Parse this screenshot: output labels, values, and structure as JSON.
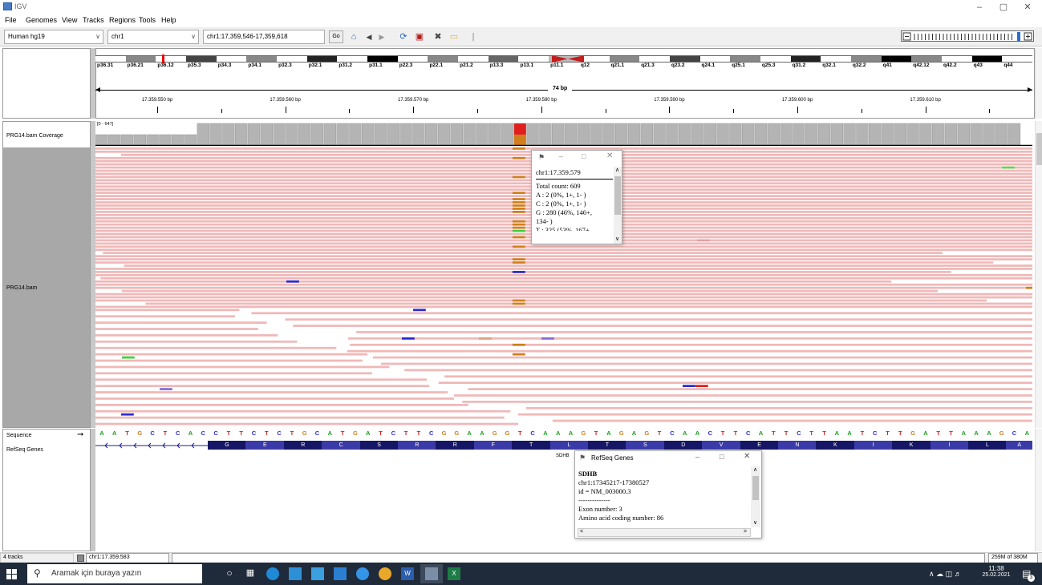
{
  "window": {
    "title": "IGV",
    "controls": [
      "–",
      "▢",
      "✕"
    ]
  },
  "menu": [
    "File",
    "Genomes",
    "View",
    "Tracks",
    "Regions",
    "Tools",
    "Help"
  ],
  "toolbar": {
    "genome": "Human hg19",
    "chromosome": "chr1",
    "locus": "chr1:17,359,546-17,359,618",
    "go_label": "Go"
  },
  "ideogram": {
    "bands": [
      "p36.31",
      "p36.21",
      "p36.12",
      "p35.3",
      "p34.3",
      "p34.1",
      "p32.3",
      "p32.1",
      "p31.2",
      "p31.1",
      "p22.3",
      "p22.1",
      "p21.2",
      "p13.3",
      "p13.1",
      "p11.1",
      "q12",
      "q21.1",
      "q21.3",
      "q23.2",
      "q24.1",
      "q25.1",
      "q25.3",
      "q31.2",
      "q32.1",
      "q32.2",
      "q41",
      "q42.12",
      "q42.2",
      "q43",
      "q44"
    ]
  },
  "ruler": {
    "span": "74 bp",
    "labels": [
      "17.359.550 bp",
      "17.359.560 bp",
      "17.359.570 bp",
      "17.359.580 bp",
      "17.359.590 bp",
      "17.359.600 bp",
      "17.359.610 bp"
    ]
  },
  "tracks": {
    "coverage_name": "PRG14.bam Coverage",
    "coverage_range": "[0 - 647]",
    "alignment_name": "PRG14.bam",
    "sequence_name": "Sequence",
    "refseq_name": "RefSeq Genes"
  },
  "sequence": "AATGCTCACCTTCTCTGCATGATCTTCGGAAGGTCAAAGTAGAGTCAACTTCATTCTTAATCTTGATTAAAGCA",
  "amino_acids": [
    "G",
    "E",
    "R",
    "C",
    "S",
    "R",
    "R",
    "F",
    "T",
    "L",
    "T",
    "S",
    "D",
    "V",
    "E",
    "N",
    "K",
    "I",
    "K",
    "I",
    "L",
    "A"
  ],
  "gene_label": "SDHB",
  "coverage_popup": {
    "locus": "chr1:17.359.579",
    "lines": [
      "Total count: 609",
      "A : 2 (0%, 1+, 1- )",
      "C : 2 (0%, 1+, 1- )",
      "G : 280 (46%, 146+,",
      "134- )",
      "T : 325 (53%, 167+,"
    ]
  },
  "refseq_popup": {
    "title": "RefSeq Genes",
    "gene": "SDHB",
    "lines": [
      "chr1:17345217-17380527",
      "id = NM_003000.3",
      "--------------",
      "Exon number: 3",
      "Amino acid coding number: 86"
    ]
  },
  "status": {
    "tracks": "4 tracks",
    "position": "chr1:17.359.583",
    "memory": "259M of 380M"
  },
  "taskbar": {
    "search_placeholder": "Aramak için buraya yazın",
    "time": "11:38",
    "date": "25.02.2021",
    "notif_count": "3"
  },
  "colors": {
    "read": "#f0b8b8",
    "coverage": "#b4b4b4",
    "mismatch_G": "#d17f1c",
    "mismatch_A": "#3dd13d",
    "mismatch_C": "#2b2bd1",
    "mismatch_T": "#e02020"
  }
}
